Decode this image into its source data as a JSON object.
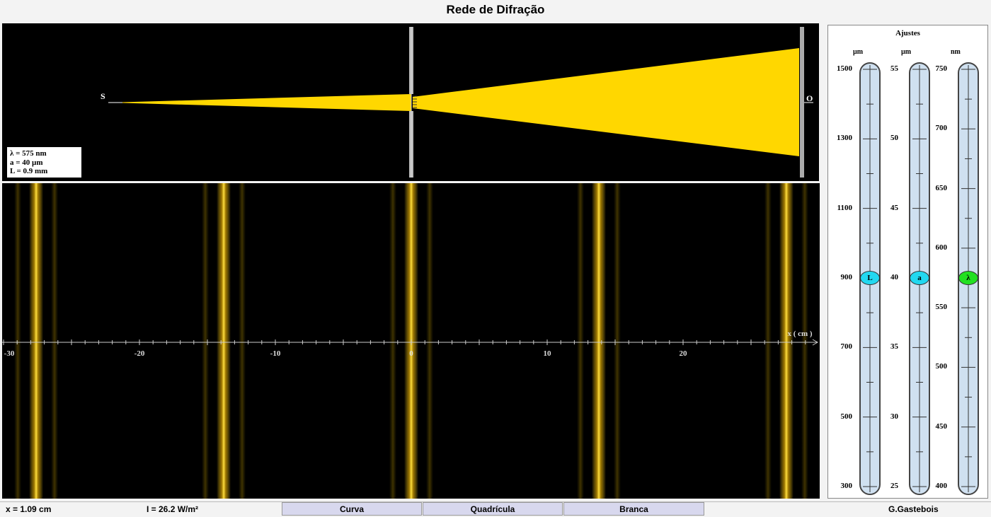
{
  "title": "Rede de Difração",
  "simulation": {
    "source_label": "S",
    "observer_label": "O",
    "info": {
      "lambda": "λ  = 575 nm",
      "a": "a  = 40 µm",
      "L": "L  = 0.9 mm"
    },
    "beam_color": "#ffd700"
  },
  "pattern": {
    "axis_label": "x ( cm )",
    "tick_labels": [
      "-30",
      "-20",
      "-10",
      "0",
      "10",
      "20"
    ],
    "fringe_positions_cm": [
      -27.6,
      -13.8,
      0,
      13.8,
      27.6
    ],
    "fringe_color": "#ffd21a"
  },
  "settings": {
    "title": "Ajustes",
    "sliders": [
      {
        "id": "L",
        "unit": "µm",
        "knob": "L",
        "knob_color": "#22d8f0",
        "value": 900,
        "min": 300,
        "max": 1500,
        "labels": [
          "1500",
          "1300",
          "1100",
          "900",
          "700",
          "500",
          "300"
        ]
      },
      {
        "id": "a",
        "unit": "µm",
        "knob": "a",
        "knob_color": "#22d8f0",
        "value": 40,
        "min": 25,
        "max": 55,
        "labels": [
          "55",
          "50",
          "45",
          "40",
          "35",
          "30",
          "25"
        ]
      },
      {
        "id": "lambda",
        "unit": "nm",
        "knob": "λ",
        "knob_color": "#22e022",
        "value": 575,
        "min": 400,
        "max": 750,
        "labels": [
          "750",
          "700",
          "650",
          "600",
          "550",
          "500",
          "450",
          "400"
        ]
      }
    ]
  },
  "status": {
    "x_readout": "x = 1.09 cm",
    "i_readout": "I = 26.2 W/m²",
    "btn_curve": "Curva",
    "btn_grid": "Quadrícula",
    "btn_white": "Branca",
    "author": "G.Gastebois"
  }
}
